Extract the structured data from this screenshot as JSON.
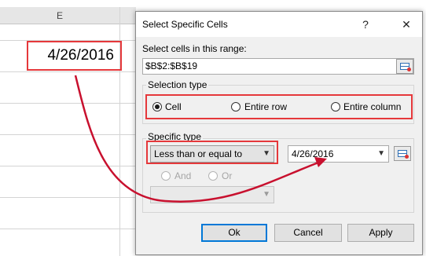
{
  "spreadsheet": {
    "column_header": "E",
    "selected_cell_value": "4/26/2016"
  },
  "dialog": {
    "title": "Select Specific Cells",
    "help_label": "?",
    "close_label": "✕",
    "range_label": "Select cells in this range:",
    "range_value": "$B$2:$B$19",
    "selection_type": {
      "label": "Selection type",
      "options": [
        "Cell",
        "Entire row",
        "Entire column"
      ],
      "selected": "Cell"
    },
    "specific_type": {
      "label": "Specific type",
      "condition": "Less than or equal to",
      "value": "4/26/2016",
      "and_label": "And",
      "or_label": "Or",
      "second_condition": ""
    },
    "buttons": {
      "ok": "Ok",
      "cancel": "Cancel",
      "apply": "Apply"
    }
  },
  "colors": {
    "highlight": "#e5383b",
    "arrow": "#c8102e",
    "accent": "#0078d7"
  }
}
